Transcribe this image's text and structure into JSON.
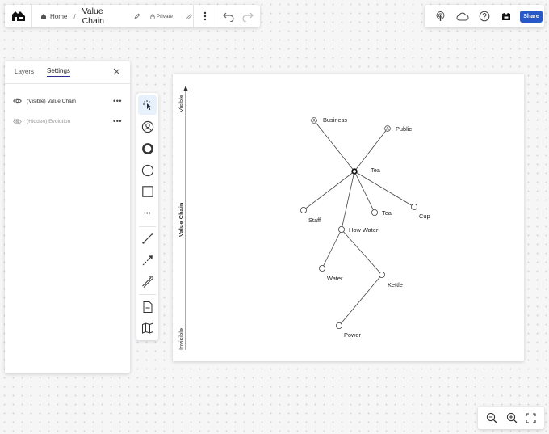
{
  "header": {
    "breadcrumb_home": "Home",
    "breadcrumb_separator": "/",
    "title": "Value Chain",
    "privacy": "Private"
  },
  "actions": {
    "share_label": "Share"
  },
  "panel": {
    "tabs": [
      {
        "label": "Layers",
        "active": false
      },
      {
        "label": "Settings",
        "active": true
      }
    ],
    "layers": [
      {
        "name": "(Visible) Value Chain",
        "visible": true,
        "menu": "•••"
      },
      {
        "name": "(Hidden) Evolution",
        "visible": false,
        "menu": "•••"
      }
    ]
  },
  "toolbox": {
    "tools": [
      "select-icon",
      "user-node-icon",
      "anchor-circle-icon",
      "component-circle-icon",
      "rectangle-icon",
      "more-icon",
      "line-icon",
      "dashed-arrow-icon",
      "double-line-arrow-icon",
      "note-icon",
      "map-icon"
    ],
    "more_label": "•••"
  },
  "map": {
    "axis": {
      "top": "Visible",
      "middle": "Value Chain",
      "bottom": "Invisible"
    },
    "components": {
      "business": "Business",
      "public": "Public",
      "tea_anchor": "Tea",
      "staff": "Staff",
      "tea": "Tea",
      "cup": "Cup",
      "how_water": "How Water",
      "water": "Water",
      "kettle": "Kettle",
      "power": "Power"
    }
  },
  "colors": {
    "accent": "#2857c8",
    "tab_underline": "#2c2c8c",
    "selected_tool_bg": "#e6f1fb"
  }
}
